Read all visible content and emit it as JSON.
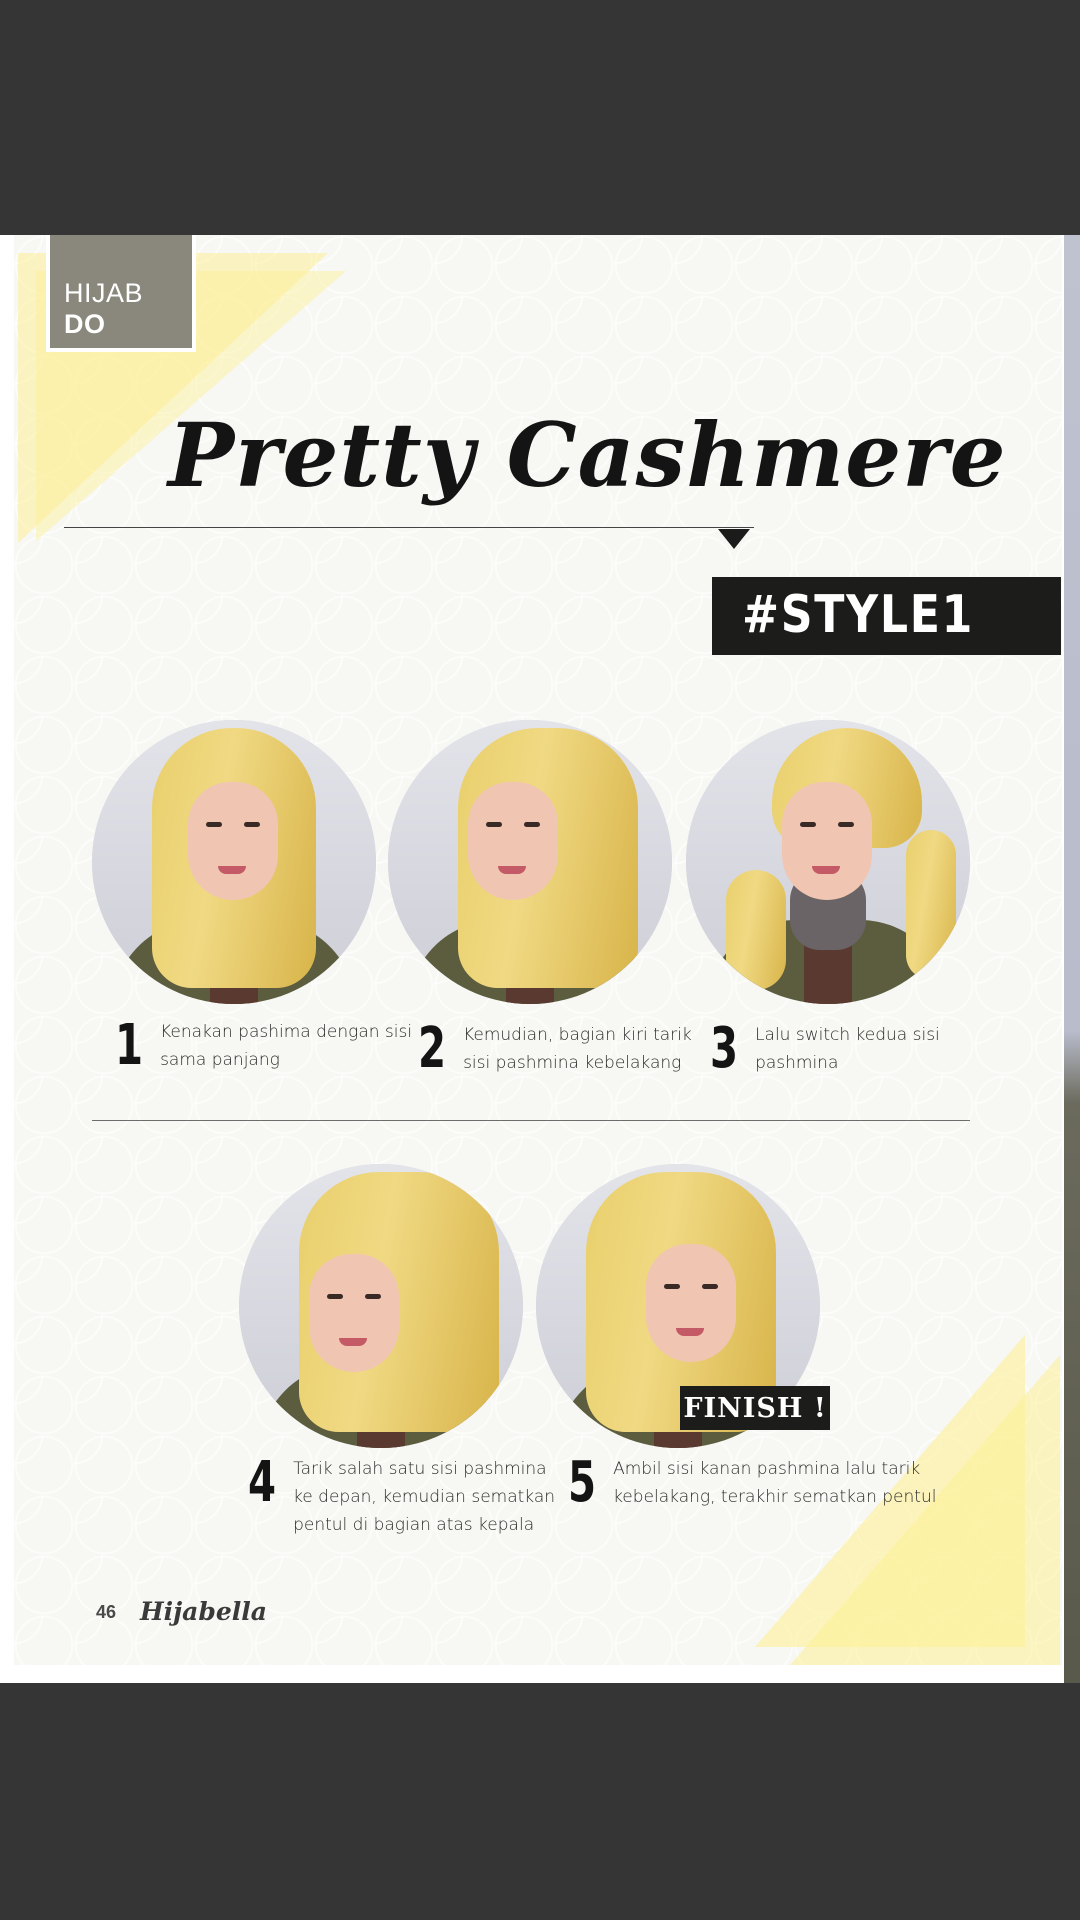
{
  "section_tag": {
    "light": "HIJAB",
    "bold": "DO"
  },
  "title": "Pretty Cashmere",
  "style_label": "#STYLE1",
  "steps": [
    {
      "number": "1",
      "text_line1": "Kenakan pashima dengan sisi",
      "text_line2": "sama panjang",
      "text_line3": ""
    },
    {
      "number": "2",
      "text_line1": "Kemudian, bagian kiri tarik",
      "text_line2": "sisi pashmina kebelakang",
      "text_line3": ""
    },
    {
      "number": "3",
      "text_line1": "Lalu switch kedua sisi",
      "text_line2": "pashmina",
      "text_line3": ""
    },
    {
      "number": "4",
      "text_line1": "Tarik salah satu sisi pashmina",
      "text_line2": "ke depan, kemudian sematkan",
      "text_line3": "pentul di bagian atas kepala"
    },
    {
      "number": "5",
      "text_line1": "Ambil sisi kanan pashmina lalu tarik",
      "text_line2": "kebelakang, terakhir sematkan pentul",
      "text_line3": ""
    }
  ],
  "finish_label": "FINISH !",
  "footer": {
    "page_number": "46",
    "brand": "Hijabella"
  },
  "colors": {
    "background": "#353535",
    "accent_yellow": "#fdef96",
    "banner": "#1c1c1a",
    "tag": "#8a887c"
  }
}
